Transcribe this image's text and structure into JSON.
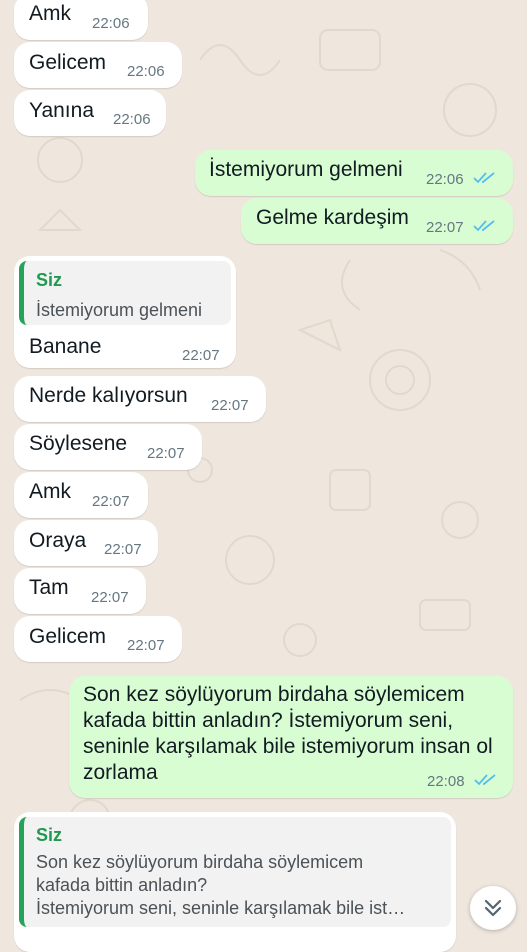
{
  "colors": {
    "background": "#efe7de",
    "incoming_bubble": "#ffffff",
    "outgoing_bubble": "#d9fdd3",
    "read_ticks": "#53bdeb",
    "quote_accent": "#25a35a"
  },
  "messages": [
    {
      "direction": "in",
      "text": "Amk",
      "time": "22:06"
    },
    {
      "direction": "in",
      "text": "Gelicem",
      "time": "22:06"
    },
    {
      "direction": "in",
      "text": "Yanına",
      "time": "22:06"
    },
    {
      "direction": "out",
      "text": "İstemiyorum gelmeni",
      "time": "22:06",
      "status": "read"
    },
    {
      "direction": "out",
      "text": "Gelme kardeşim",
      "time": "22:07",
      "status": "read"
    },
    {
      "direction": "in",
      "quote": {
        "author": "Siz",
        "text": "İstemiyorum gelmeni"
      },
      "text": "Banane",
      "time": "22:07"
    },
    {
      "direction": "in",
      "text": "Nerde kalıyorsun",
      "time": "22:07"
    },
    {
      "direction": "in",
      "text": "Söylesene",
      "time": "22:07"
    },
    {
      "direction": "in",
      "text": "Amk",
      "time": "22:07"
    },
    {
      "direction": "in",
      "text": "Oraya",
      "time": "22:07"
    },
    {
      "direction": "in",
      "text": "Tam",
      "time": "22:07"
    },
    {
      "direction": "in",
      "text": "Gelicem",
      "time": "22:07"
    },
    {
      "direction": "out",
      "text": "Son kez söylüyorum birdaha söylemicem kafada bittin anladın? İstemiyorum seni, seninle karşılamak bile istemiyorum insan ol zorlama",
      "time": "22:08",
      "status": "read"
    },
    {
      "direction": "in",
      "quote": {
        "author": "Siz",
        "text": "Son kez söylüyorum birdaha söylemicem\nkafada bittin anladın?\nİstemiyorum seni, seninle karşılamak bile ist…"
      }
    }
  ],
  "icons": {
    "read_receipt": "double-check-icon",
    "scroll_down": "chevrons-down-icon"
  }
}
